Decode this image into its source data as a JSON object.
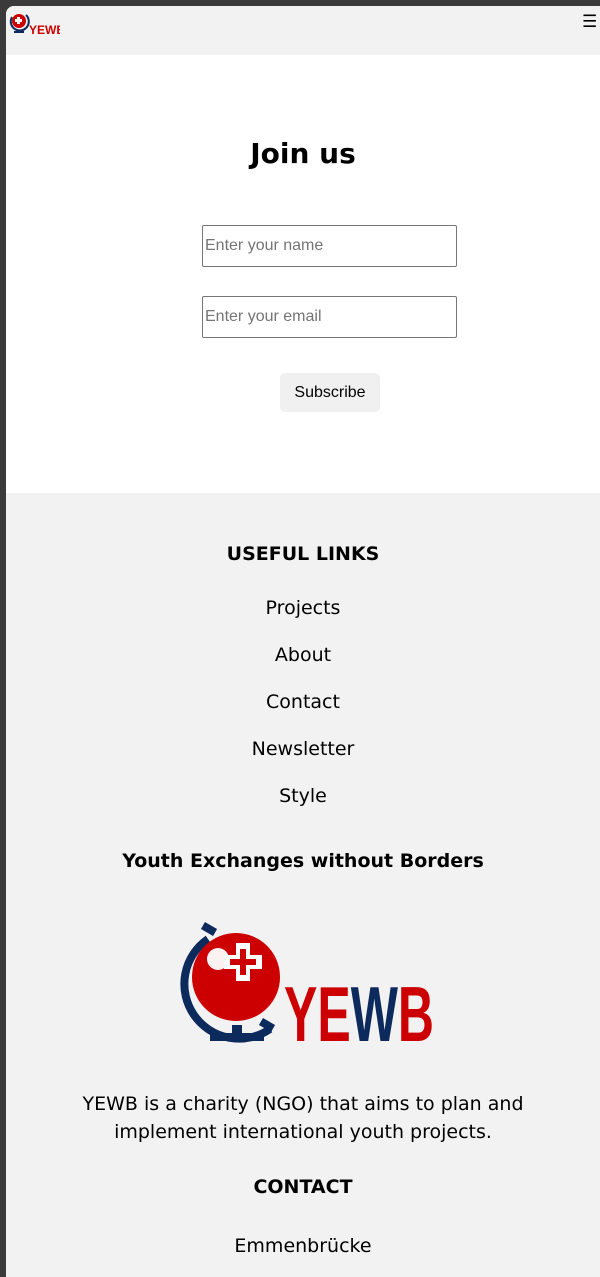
{
  "header": {
    "logo_text": "YEWB",
    "menu_icon": "hamburger-icon"
  },
  "join": {
    "title": "Join us",
    "name_placeholder": "Enter your name",
    "email_placeholder": "Enter your email",
    "subscribe_label": "Subscribe"
  },
  "footer": {
    "useful_links_heading": "USEFUL LINKS",
    "links": [
      "Projects",
      "About",
      "Contact",
      "Newsletter",
      "Style"
    ],
    "org_name": "Youth Exchanges without Borders",
    "logo_text": "YEWB",
    "description": "YEWB is a charity (NGO) that aims to plan and implement international youth projects.",
    "contact_heading": "CONTACT",
    "city": "Emmenbrücke"
  },
  "colors": {
    "brand_red": "#cc0000",
    "brand_navy": "#0d2a5c",
    "footer_bg": "#f2f2f2"
  }
}
